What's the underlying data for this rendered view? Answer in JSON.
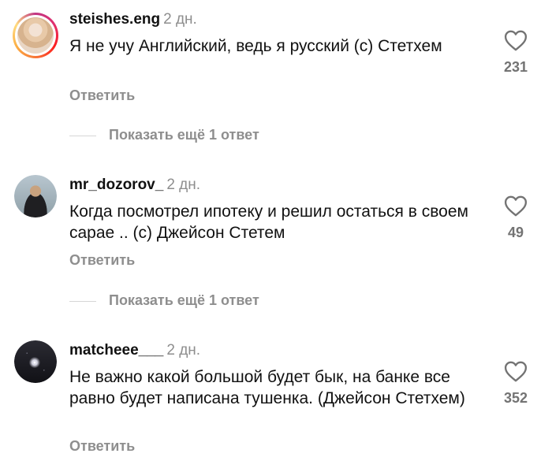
{
  "comments": [
    {
      "username": "steishes.eng",
      "time": "2 дн.",
      "text": "Я не учу Английский, ведь я русский (с) Стетхем",
      "reply_label": "Ответить",
      "like_count": "231",
      "show_more": "Показать ещё 1 ответ"
    },
    {
      "username": "mr_dozorov_",
      "time": "2 дн.",
      "text": "Когда посмотрел ипотеку и решил остаться в своем сарае .. (с) Джейсон Стетем",
      "reply_label": "Ответить",
      "like_count": "49",
      "show_more": "Показать ещё 1 ответ"
    },
    {
      "username": "matcheee___",
      "time": "2 дн.",
      "text": "Не важно какой большой будет бык, на банке все равно будет написана тушенка. (Джейсон Стетхем)",
      "reply_label": "Ответить",
      "like_count": "352"
    }
  ],
  "icons": {
    "like": "heart-outline-icon"
  },
  "colors": {
    "muted": "#8e8e8e",
    "story_ring": "#e1306c"
  }
}
